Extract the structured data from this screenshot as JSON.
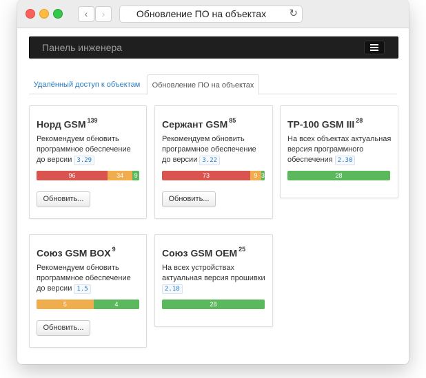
{
  "browser": {
    "url_title": "Обновление ПО на объектах"
  },
  "navbar": {
    "brand": "Панель инженера"
  },
  "tabs": [
    {
      "label": "Удалённый доступ к объектам",
      "active": false
    },
    {
      "label": "Обновление ПО на объектах",
      "active": true
    }
  ],
  "cards": [
    {
      "title": "Норд GSM",
      "count": "139",
      "desc_prefix": "Рекомендуем обновить программное обеспечение до версии",
      "version": "3.29",
      "segments": [
        {
          "label": "96",
          "color": "red",
          "value": 96
        },
        {
          "label": "34",
          "color": "orange",
          "value": 34
        },
        {
          "label": "9",
          "color": "green",
          "value": 9
        }
      ],
      "button": "Обновить..."
    },
    {
      "title": "Сержант GSM",
      "count": "85",
      "desc_prefix": "Рекомендуем обновить программное обеспечение до версии",
      "version": "3.22",
      "segments": [
        {
          "label": "73",
          "color": "red",
          "value": 73
        },
        {
          "label": "9",
          "color": "orange",
          "value": 9
        },
        {
          "label": "3",
          "color": "green",
          "value": 3
        }
      ],
      "button": "Обновить..."
    },
    {
      "title": "ТР-100 GSM III",
      "count": "28",
      "desc_prefix": "На всех объектах актуальная версия программного обеспечения",
      "version": "2.30",
      "segments": [
        {
          "label": "28",
          "color": "green",
          "value": 28
        }
      ],
      "button": ""
    },
    {
      "title": "Союз GSM BOX",
      "count": "9",
      "desc_prefix": "Рекомендуем обновить программное обеспечение до версии",
      "version": "1.5",
      "segments": [
        {
          "label": "5",
          "color": "orange",
          "value": 5
        },
        {
          "label": "4",
          "color": "green",
          "value": 4
        }
      ],
      "button": "Обновить..."
    },
    {
      "title": "Союз GSM OEM",
      "count": "25",
      "desc_prefix": "На всех устройствах актуальная версия прошивки",
      "version": "2.18",
      "segments": [
        {
          "label": "28",
          "color": "green",
          "value": 28
        }
      ],
      "button": ""
    }
  ],
  "colors": {
    "red": "#d9534f",
    "orange": "#f0ad4e",
    "green": "#5cb85c",
    "navbar": "#1f1f1f",
    "link": "#2a7bbf"
  }
}
